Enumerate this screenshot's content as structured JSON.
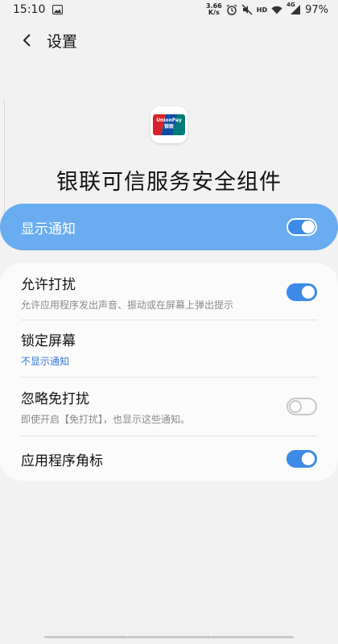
{
  "status_bar": {
    "time": "15:10",
    "net_speed_value": "3.66",
    "net_speed_unit": "K/s",
    "hd_label": "HD",
    "network_label": "4G",
    "battery": "97%"
  },
  "app_bar": {
    "title": "设置"
  },
  "hero": {
    "app_name": "银联可信服务安全组件",
    "logo_text_top": "UnionPay",
    "logo_text_bottom": "银联"
  },
  "master": {
    "label": "显示通知",
    "enabled": true
  },
  "settings": [
    {
      "title": "允许打扰",
      "subtitle": "允许应用程序发出声音、振动或在屏幕上弹出提示",
      "toggle": "on"
    },
    {
      "title": "锁定屏幕",
      "subtitle": "不显示通知"
    },
    {
      "title": "忽略免打扰",
      "subtitle": "即使开启【免打扰】，也显示这些通知。",
      "toggle": "off"
    },
    {
      "title": "应用程序角标",
      "toggle": "on"
    }
  ],
  "colors": {
    "accent": "#3d8ae8",
    "master_bg": "#6aacf0",
    "link_blue": "#3478d8"
  }
}
